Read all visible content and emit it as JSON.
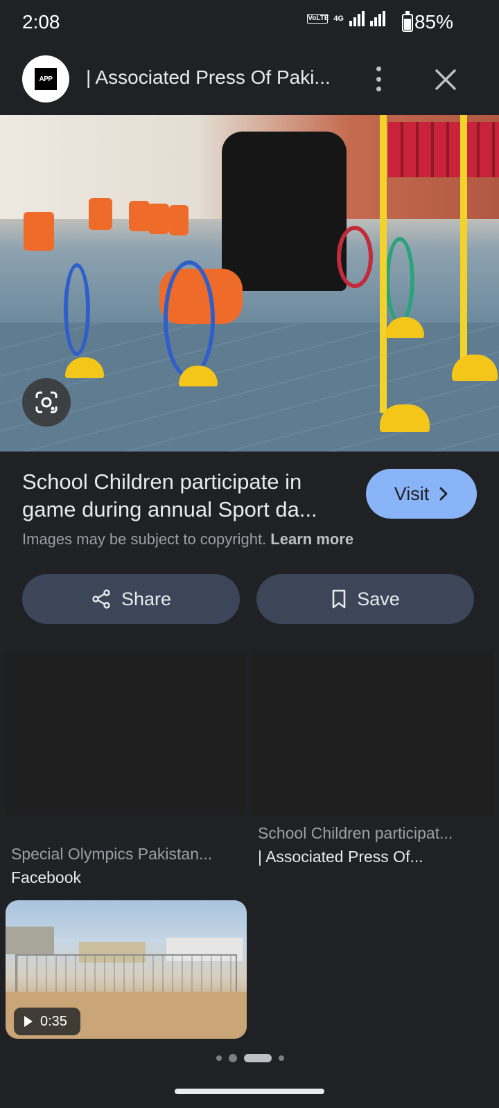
{
  "status": {
    "time": "2:08",
    "net_top": "Vo LTE2",
    "net_4g": "4G",
    "battery_pct": "85%"
  },
  "header": {
    "logo_text": "APP",
    "site_name": "| Associated Press Of Paki..."
  },
  "hero": {
    "alt": "School children in orange vests playing hoop game in indoor sports hall"
  },
  "result": {
    "title_line1": "School Children participate in",
    "title_line2": "game during annual Sport da...",
    "visit_label": "Visit",
    "copyright_text": "Images may be subject to copyright.",
    "learn_more": "Learn more"
  },
  "actions": {
    "share_label": "Share",
    "save_label": "Save"
  },
  "grid": {
    "left": {
      "title": "Special Olympics Pakistan...",
      "source": "Facebook"
    },
    "right": {
      "title": "School Children participat...",
      "source": "| Associated Press Of..."
    },
    "video": {
      "duration": "0:35"
    }
  },
  "colors": {
    "background": "#202124",
    "accent": "#8ab4f8",
    "button": "#3c4658"
  }
}
